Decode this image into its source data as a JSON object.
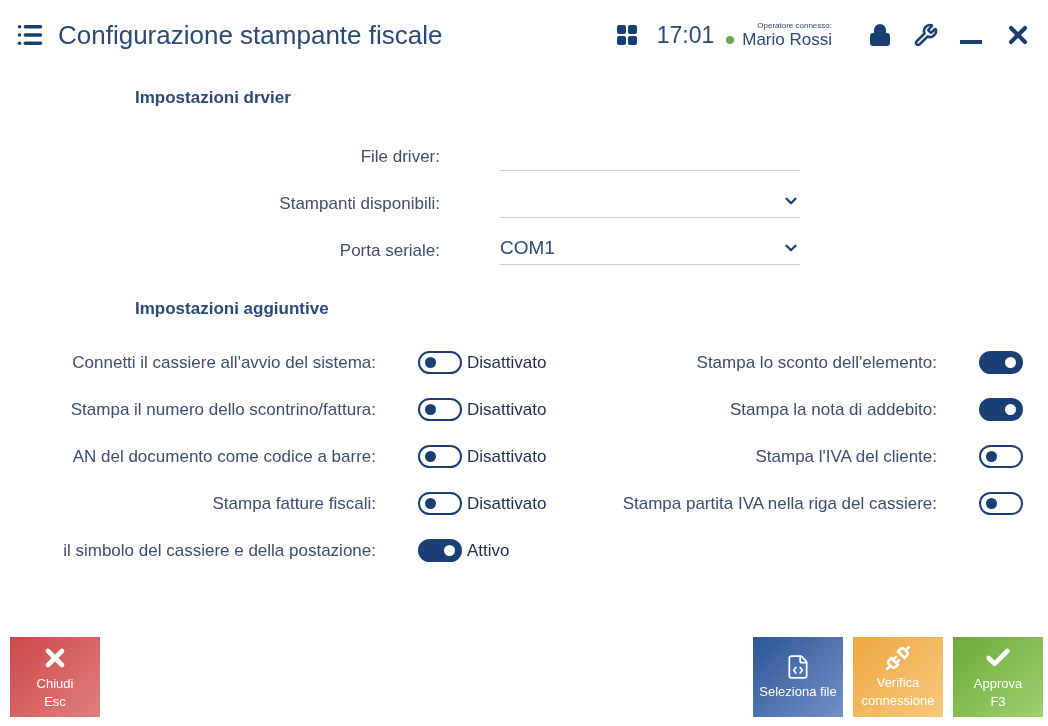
{
  "header": {
    "title": "Configurazione stampante fiscale",
    "time": "17:01",
    "operator_caption": "Operatore connesso:",
    "operator_name": "Mario Rossi",
    "online": true
  },
  "driver_section": {
    "title": "Impostazioni drvier",
    "fields": [
      {
        "kind": "text",
        "label": "File driver:"
      },
      {
        "kind": "select",
        "label": "Stampanti disponibili:"
      },
      {
        "kind": "select",
        "label": "Porta seriale:",
        "value": "COM1"
      }
    ]
  },
  "additional_section": {
    "title": "Impostazioni aggiuntive",
    "left_settings": [
      {
        "label": "Connetti il cassiere all'avvio del sistema:",
        "on": false,
        "status": "Disattivato"
      },
      {
        "label": "Stampa il numero dello scontrino/fattura:",
        "on": false,
        "status": "Disattivato"
      },
      {
        "label": "AN del documento come codice a barre:",
        "on": false,
        "status": "Disattivato"
      },
      {
        "label": "Stampa fatture fiscali:",
        "on": false,
        "status": "Disattivato"
      },
      {
        "label": "il simbolo del cassiere e della postazione:",
        "on": true,
        "status": "Attivo"
      }
    ],
    "right_settings": [
      {
        "label": "Stampa lo sconto dell'elemento:",
        "on": true
      },
      {
        "label": "Stampa la nota di addebito:",
        "on": true
      },
      {
        "label": "Stampa l'IVA del cliente:",
        "on": false
      },
      {
        "label": "Stampa partita IVA nella riga del cassiere:",
        "on": false
      }
    ]
  },
  "buttons": [
    {
      "kind": "close",
      "label": "Chiudi",
      "key": "Esc"
    },
    {
      "kind": "file",
      "label": "Seleziona file"
    },
    {
      "kind": "connection",
      "label": "Verifica connessione"
    },
    {
      "kind": "approve",
      "label": "Approva",
      "key": "F3"
    }
  ]
}
